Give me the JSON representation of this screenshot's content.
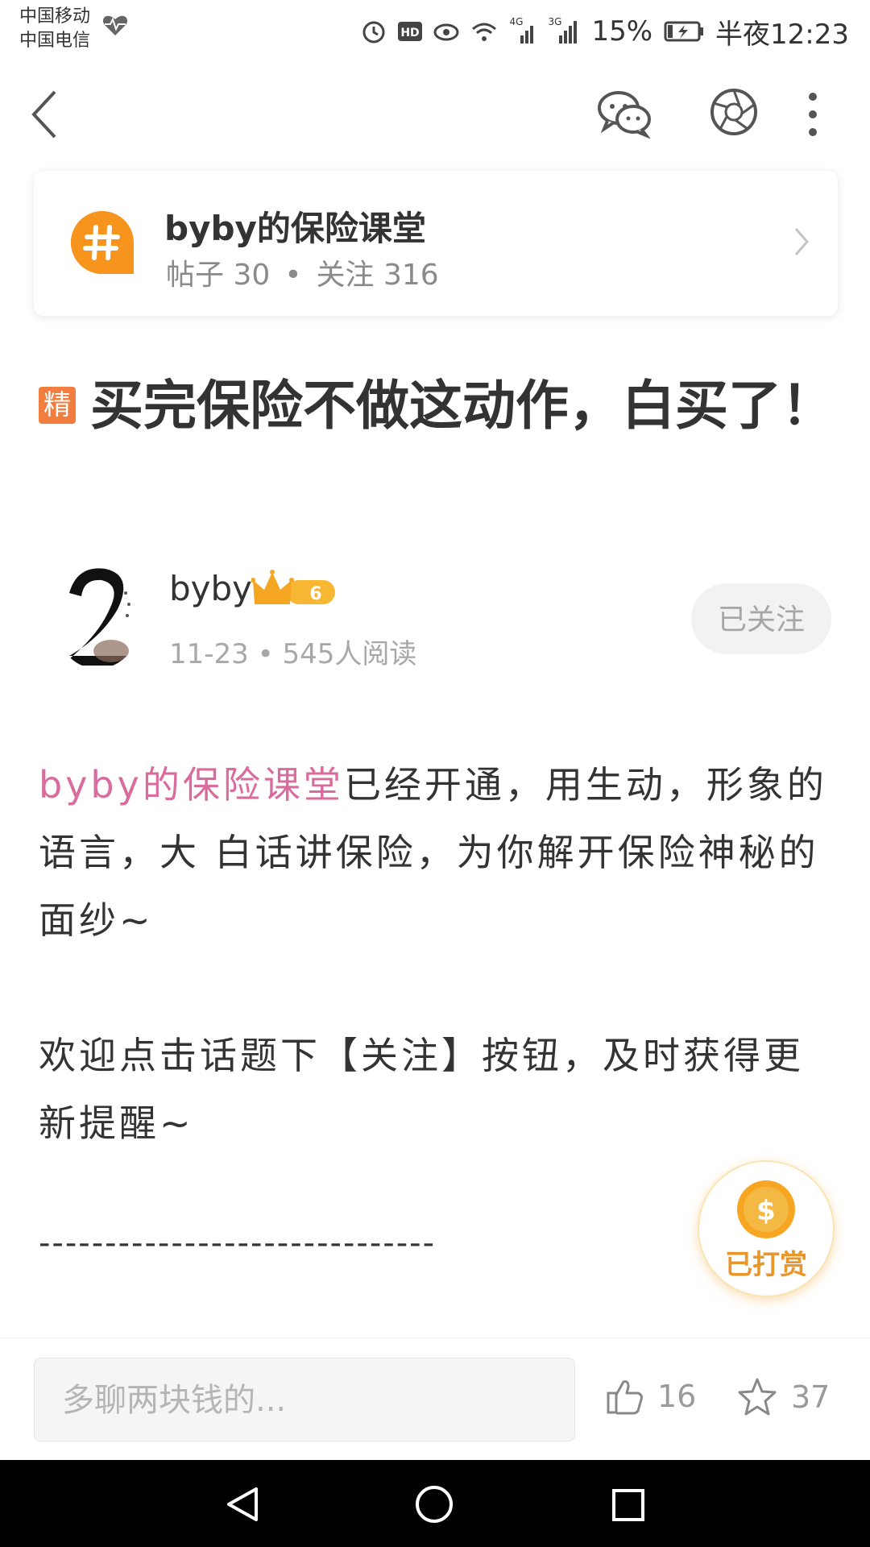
{
  "status_bar": {
    "carrier_1": "中国移动",
    "carrier_2": "中国电信",
    "battery": "15%",
    "time": "半夜12:23",
    "network_1": "4G",
    "network_2": "3G"
  },
  "topic": {
    "title": "byby的保险课堂",
    "posts_label": "帖子 30",
    "dot": "•",
    "followers_label": "关注 316",
    "accent": "#f7941d"
  },
  "post": {
    "badge": "精",
    "title": "买完保险不做这动作，白买了！"
  },
  "author": {
    "name": "byby",
    "level": "6",
    "meta": "11-23 • 545人阅读",
    "follow_label": "已关注"
  },
  "body": {
    "p1_link": "byby的保险课堂",
    "p1_rest": "已经开通，用生动，形象的语言，大 白话讲保险，为你解开保险神秘的面纱~",
    "p2": "欢迎点击话题下【关注】按钮，及时获得更新提醒~",
    "divider": "------------------------------"
  },
  "reward": {
    "symbol": "$",
    "label": "已打赏"
  },
  "action_bar": {
    "comment_placeholder": "多聊两块钱的...",
    "like_count": "16",
    "fav_count": "37"
  },
  "icons": {
    "back": "back-icon",
    "wechat": "wechat-icon",
    "moments": "moments-icon",
    "more": "more-icon",
    "topic": "hashtag-icon",
    "like": "thumbs-up-icon",
    "fav": "star-icon"
  },
  "colors": {
    "link": "#d96b9d",
    "badge": "#f17d3e",
    "reward": "#e8962a"
  }
}
